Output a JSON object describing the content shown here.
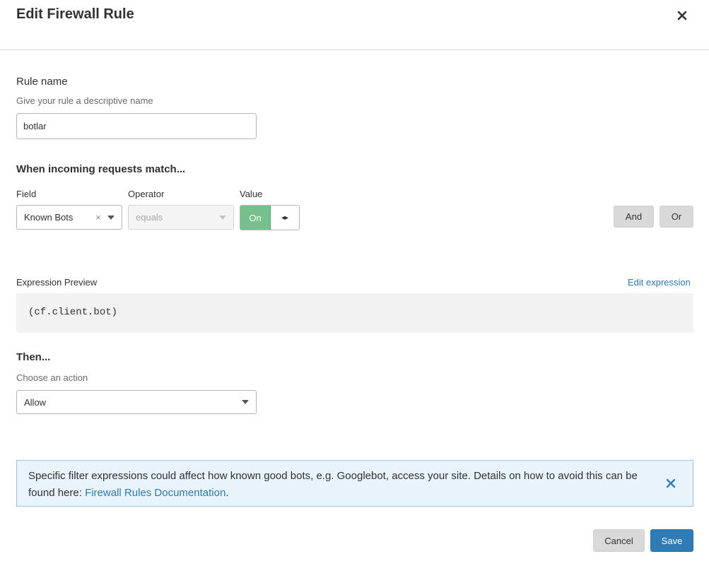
{
  "dialog": {
    "title": "Edit Firewall Rule"
  },
  "rule_name": {
    "label": "Rule name",
    "help": "Give your rule a descriptive name",
    "value": "botlar"
  },
  "match": {
    "heading": "When incoming requests match...",
    "field_label": "Field",
    "operator_label": "Operator",
    "value_label": "Value",
    "field_value": "Known Bots",
    "clear_glyph": "×",
    "operator_value": "equals",
    "toggle_on_label": "On",
    "toggle_handle_glyph": "◂▸",
    "and_label": "And",
    "or_label": "Or"
  },
  "expression": {
    "label": "Expression Preview",
    "edit_link": "Edit expression",
    "code": "(cf.client.bot)"
  },
  "then": {
    "heading": "Then...",
    "help": "Choose an action",
    "action_value": "Allow"
  },
  "notice": {
    "text_before": "Specific filter expressions could affect how known good bots, e.g. Googlebot, access your site. Details on how to avoid this can be found here: ",
    "link_text": "Firewall Rules Documentation",
    "text_after": "."
  },
  "footer": {
    "cancel_label": "Cancel",
    "save_label": "Save"
  },
  "colors": {
    "accent": "#2f7bb6",
    "toggle_on": "#76c08d",
    "notice_bg": "#e9f3fb",
    "link": "#2e7ab0"
  },
  "icons": {
    "close": "close-icon",
    "dropdown": "chevron-down-icon",
    "notice_close": "close-icon"
  }
}
